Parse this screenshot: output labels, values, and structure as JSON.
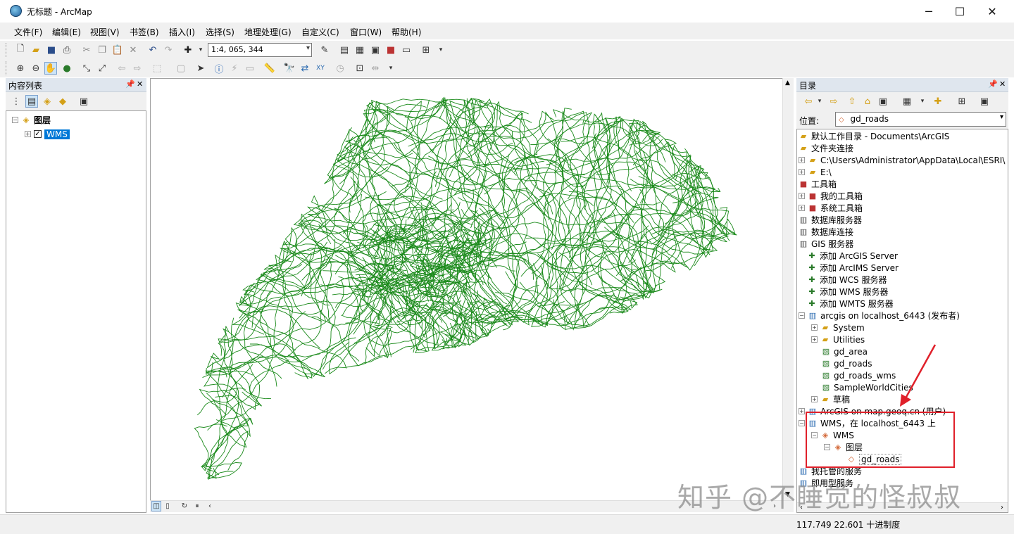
{
  "window": {
    "title": "无标题 - ArcMap"
  },
  "menu": [
    "文件(F)",
    "编辑(E)",
    "视图(V)",
    "书签(B)",
    "插入(I)",
    "选择(S)",
    "地理处理(G)",
    "自定义(C)",
    "窗口(W)",
    "帮助(H)"
  ],
  "toolbar": {
    "scale": "1:4, 065, 344"
  },
  "toc": {
    "title": "内容列表",
    "root": "图层",
    "layer": "WMS"
  },
  "catalog": {
    "title": "目录",
    "location_label": "位置:",
    "location_value": "gd_roads",
    "items": [
      "默认工作目录 - Documents\\ArcGIS",
      "文件夹连接",
      "C:\\Users\\Administrator\\AppData\\Local\\ESRI\\",
      "E:\\",
      "工具箱",
      "我的工具箱",
      "系统工具箱",
      "数据库服务器",
      "数据库连接",
      "GIS 服务器",
      "添加 ArcGIS Server",
      "添加 ArcIMS Server",
      "添加 WCS 服务器",
      "添加 WMS 服务器",
      "添加 WMTS 服务器",
      "arcgis on localhost_6443 (发布者)",
      "System",
      "Utilities",
      "gd_area",
      "gd_roads",
      "gd_roads_wms",
      "SampleWorldCities",
      "草稿",
      "ArcGIS on map.geoq.cn (用户)",
      "WMS，在 localhost_6443 上",
      "WMS",
      "图层",
      "gd_roads",
      "我托管的服务",
      "即用型服务"
    ]
  },
  "status": {
    "coords": "117.749  22.601 十进制度"
  },
  "watermark": "知乎 @不睡觉的怪叔叔",
  "colors": {
    "roads": "#1a8a1a",
    "highlight": "#e0202a",
    "selection": "#0078d7"
  }
}
